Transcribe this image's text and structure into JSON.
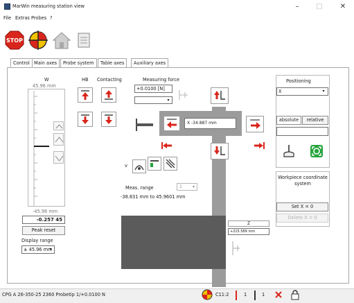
{
  "window": {
    "title": "MarWin measuring station view"
  },
  "menu": [
    "File",
    "Extras",
    "Probes",
    "?"
  ],
  "tabs": [
    "Control",
    "Main axes",
    "Probe system",
    "Table axes",
    "Auxiliary axes"
  ],
  "left_gauge": {
    "header": "W",
    "top_value": "45.96 mm",
    "bottom_value": "-45.96 mm",
    "current_value": "-0.257 45",
    "peak_reset": "Peak reset",
    "display_range_label": "Display range",
    "display_range_value": "± 45.96 mm"
  },
  "headers": {
    "hb": "HB",
    "contacting": "Contacting",
    "measuring_force": "Measuring force"
  },
  "measuring_force_value": "+0.0100 [N]",
  "x_readout": "X -34.887 mm",
  "v_label": "v",
  "meas_range": {
    "label": "Meas. range",
    "select_value": "1",
    "text": "-38.831 mm to 45.9601 mm"
  },
  "z_axis": {
    "label": "Z",
    "value": "+215.589 mm"
  },
  "positioning": {
    "title": "Positioning",
    "axis_value": "X",
    "absolute": "absolute",
    "relative": "relative"
  },
  "workpiece": {
    "title": "Workpiece coordinate system",
    "set_button": "Set X = 0",
    "delete_button": "Delete X = 0"
  },
  "status": {
    "text": "CPG A 26-350-25 2360 Probetip 1/+0.0100 N",
    "c_label": "C11:2",
    "count1": "1",
    "count2": "1"
  },
  "colors": {
    "red": "#d9261c",
    "green": "#25a43c",
    "gray": "#9b9b9b",
    "dark": "#5b5b5b"
  }
}
